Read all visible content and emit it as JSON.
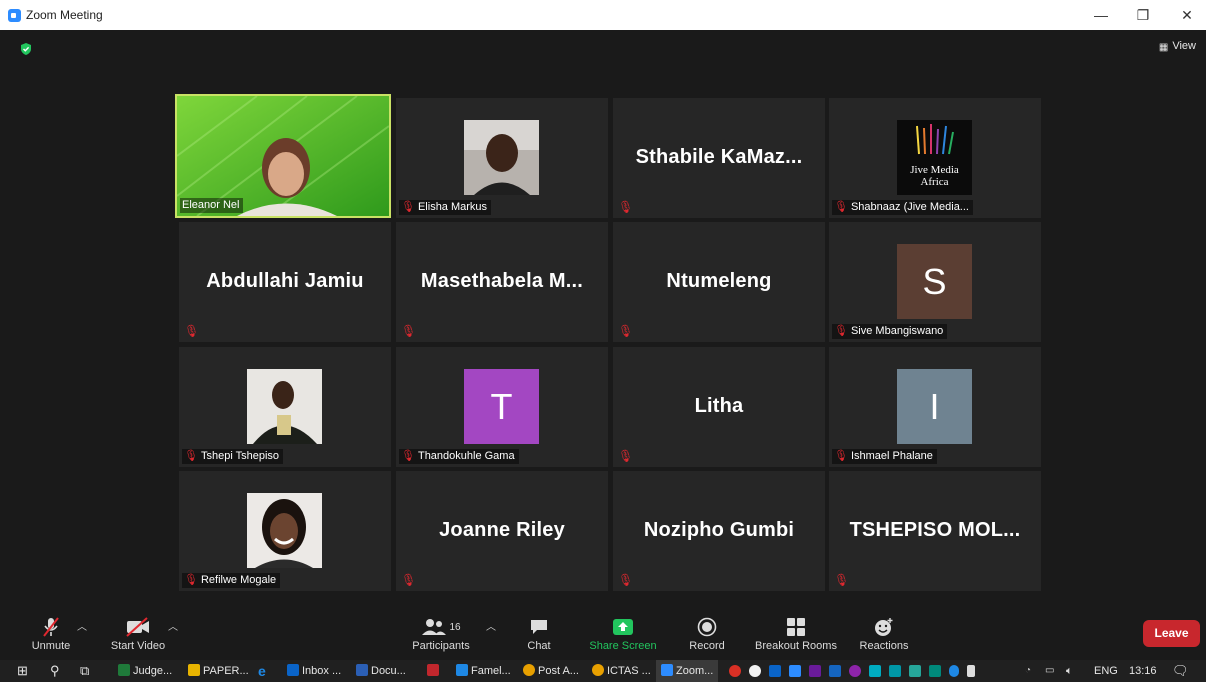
{
  "window": {
    "title": "Zoom Meeting",
    "controls": [
      "—",
      "❐",
      "✕"
    ]
  },
  "view_label": "View",
  "colors": {
    "active_border": "#c9e265",
    "mute_red": "#e0282f",
    "leave_red": "#c8272d",
    "share_green": "#22c55e"
  },
  "participants": [
    {
      "name": "Eleanor Nel",
      "type": "video",
      "muted": false,
      "active": true
    },
    {
      "name": "Elisha Markus",
      "type": "photo",
      "muted": true
    },
    {
      "name": "Sthabile  KaMaz...",
      "type": "name",
      "muted": true
    },
    {
      "name": "Shabnaaz (Jive Media...",
      "type": "logo",
      "logo_lines": [
        "Jive Media",
        "Africa"
      ],
      "muted": true
    },
    {
      "name": "Abdullahi Jamiu",
      "type": "name",
      "muted": true
    },
    {
      "name": "Masethabela  M...",
      "type": "name",
      "muted": true
    },
    {
      "name": "Ntumeleng",
      "type": "name",
      "muted": true
    },
    {
      "name": "Sive Mbangiswano",
      "type": "avatar",
      "letter": "S",
      "color": "#5b3e33",
      "muted": true
    },
    {
      "name": "Tshepi Tshepiso",
      "type": "photo",
      "muted": true
    },
    {
      "name": "Thandokuhle Gama",
      "type": "avatar",
      "letter": "T",
      "color": "#a347c2",
      "muted": true
    },
    {
      "name": "Litha",
      "type": "name",
      "muted": true
    },
    {
      "name": "Ishmael Phalane",
      "type": "avatar",
      "letter": "I",
      "color": "#6f8391",
      "muted": true
    },
    {
      "name": "Refilwe Mogale",
      "type": "photo",
      "muted": true
    },
    {
      "name": "Joanne Riley",
      "type": "name",
      "muted": true
    },
    {
      "name": "Nozipho Gumbi",
      "type": "name",
      "muted": true
    },
    {
      "name": "TSHEPISO  MOL...",
      "type": "name",
      "muted": true
    }
  ],
  "toolbar": {
    "unmute": "Unmute",
    "start_video": "Start Video",
    "participants": "Participants",
    "participants_count": "16",
    "chat": "Chat",
    "share_screen": "Share Screen",
    "record": "Record",
    "breakout_rooms": "Breakout Rooms",
    "reactions": "Reactions",
    "leave": "Leave"
  },
  "taskbar": {
    "items": [
      {
        "label": "Judge...",
        "icon_color": "#1f7a3a"
      },
      {
        "label": "PAPER...",
        "icon_color": "#e8b400"
      },
      {
        "label": "Inbox ...",
        "icon_color": "#0a64c8"
      },
      {
        "label": "Docu...",
        "icon_color": "#2b5fb5"
      },
      {
        "label": "",
        "icon_color": "#c1272d"
      },
      {
        "label": "Famel...",
        "icon_color": "#1e88e5"
      },
      {
        "label": "Post A...",
        "icon_color": "#e8a000"
      },
      {
        "label": "ICTAS ...",
        "icon_color": "#e8a000"
      },
      {
        "label": "Zoom...",
        "icon_color": "#2D8CFF"
      }
    ],
    "language": "ENG",
    "time": "13:16"
  }
}
